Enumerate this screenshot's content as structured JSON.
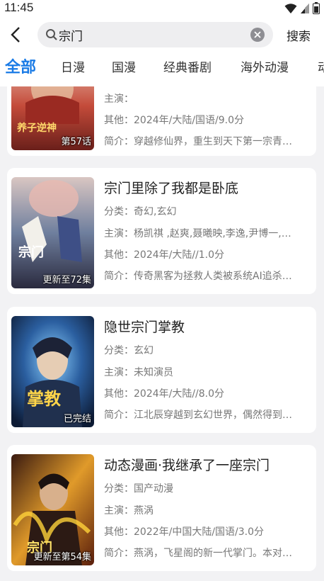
{
  "status_bar": {
    "time": "11:45"
  },
  "search": {
    "query": "宗门",
    "button_label": "搜索"
  },
  "tabs": [
    "全部",
    "日漫",
    "国漫",
    "经典番剧",
    "海外动漫",
    "动"
  ],
  "results": [
    {
      "title": "",
      "category": "",
      "cast": "主演：",
      "other": "其他：2024年/大陆/国语/9.0分",
      "intro": "简介：穿越修仙界，重生到天下第一宗青…",
      "badge": "第57话"
    },
    {
      "title": "宗门里除了我都是卧底",
      "category": "分类：奇幻,玄幻",
      "cast": "主演：杨凯祺 ,赵爽,聂曦映,李逸,尹博一,…",
      "other": "其他：2024年/大陆//1.0分",
      "intro": "简介：传奇黑客为拯救人类被系统AI追杀…",
      "badge": "更新至72集"
    },
    {
      "title": "隐世宗门掌教",
      "category": "分类：玄幻",
      "cast": "主演：未知演员",
      "other": "其他：2024年/大陆//8.0分",
      "intro": "简介：江北辰穿越到玄幻世界，偶然得到…",
      "badge": "已完结"
    },
    {
      "title": "动态漫画·我继承了一座宗门",
      "category": "分类：国产动漫",
      "cast": "主演：燕涡",
      "other": "其他：2022年/中国大陆/国语/3.0分",
      "intro": "简介：燕涡，飞星阁的新一代掌门。本对…",
      "badge": "更新至第54集"
    }
  ],
  "colors": {
    "accent": "#1a7be6",
    "background": "#f2f2f4"
  }
}
